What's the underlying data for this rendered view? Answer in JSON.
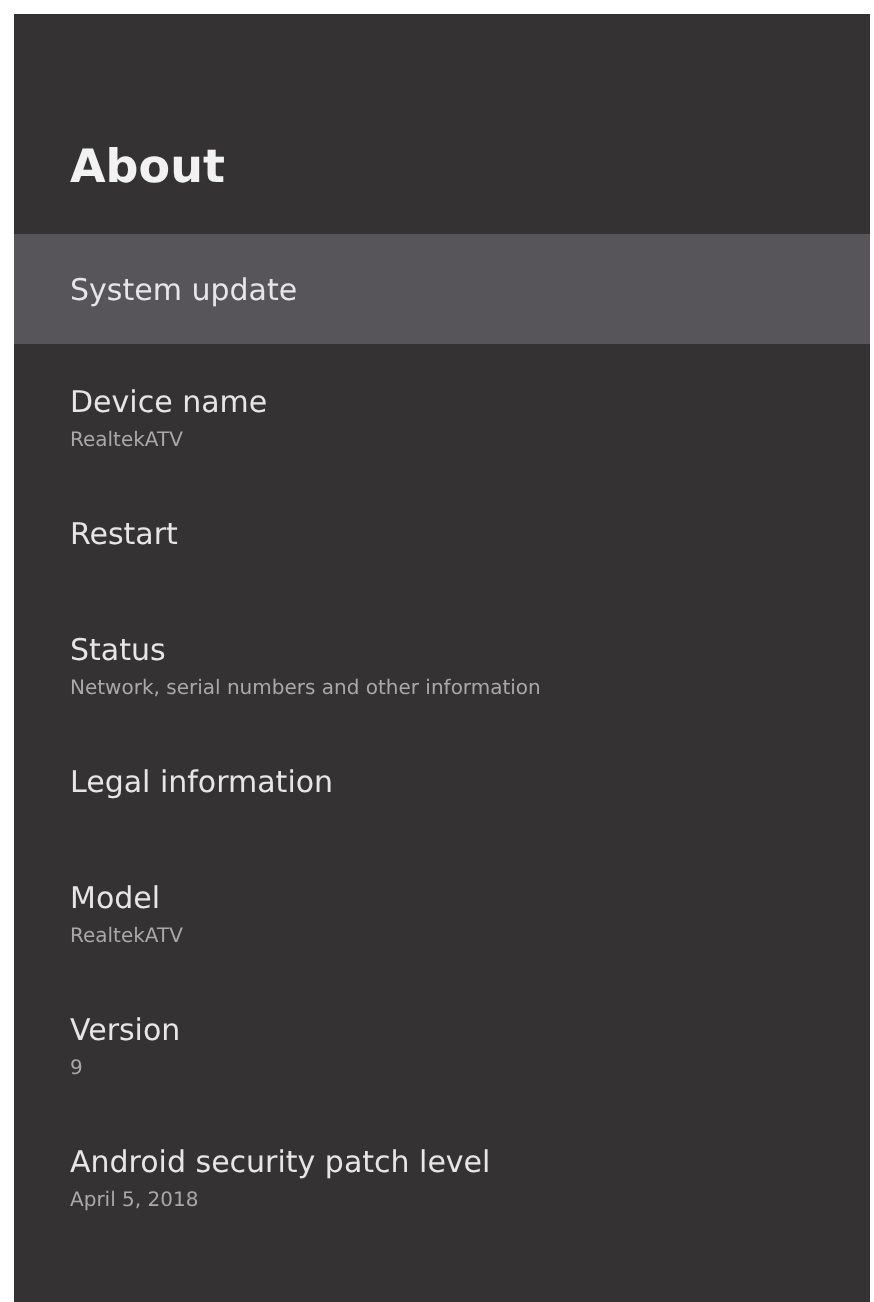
{
  "header": {
    "title": "About"
  },
  "items": [
    {
      "title": "System update",
      "selected": true
    },
    {
      "title": "Device name",
      "subtitle": "RealtekATV",
      "selected": false
    },
    {
      "title": "Restart",
      "selected": false
    },
    {
      "title": "Status",
      "subtitle": "Network, serial numbers and other information",
      "selected": false
    },
    {
      "title": "Legal information",
      "selected": false
    },
    {
      "title": "Model",
      "subtitle": "RealtekATV",
      "selected": false
    },
    {
      "title": "Version",
      "subtitle": "9",
      "selected": false
    },
    {
      "title": "Android security patch level",
      "subtitle": "April 5, 2018",
      "selected": false
    }
  ]
}
